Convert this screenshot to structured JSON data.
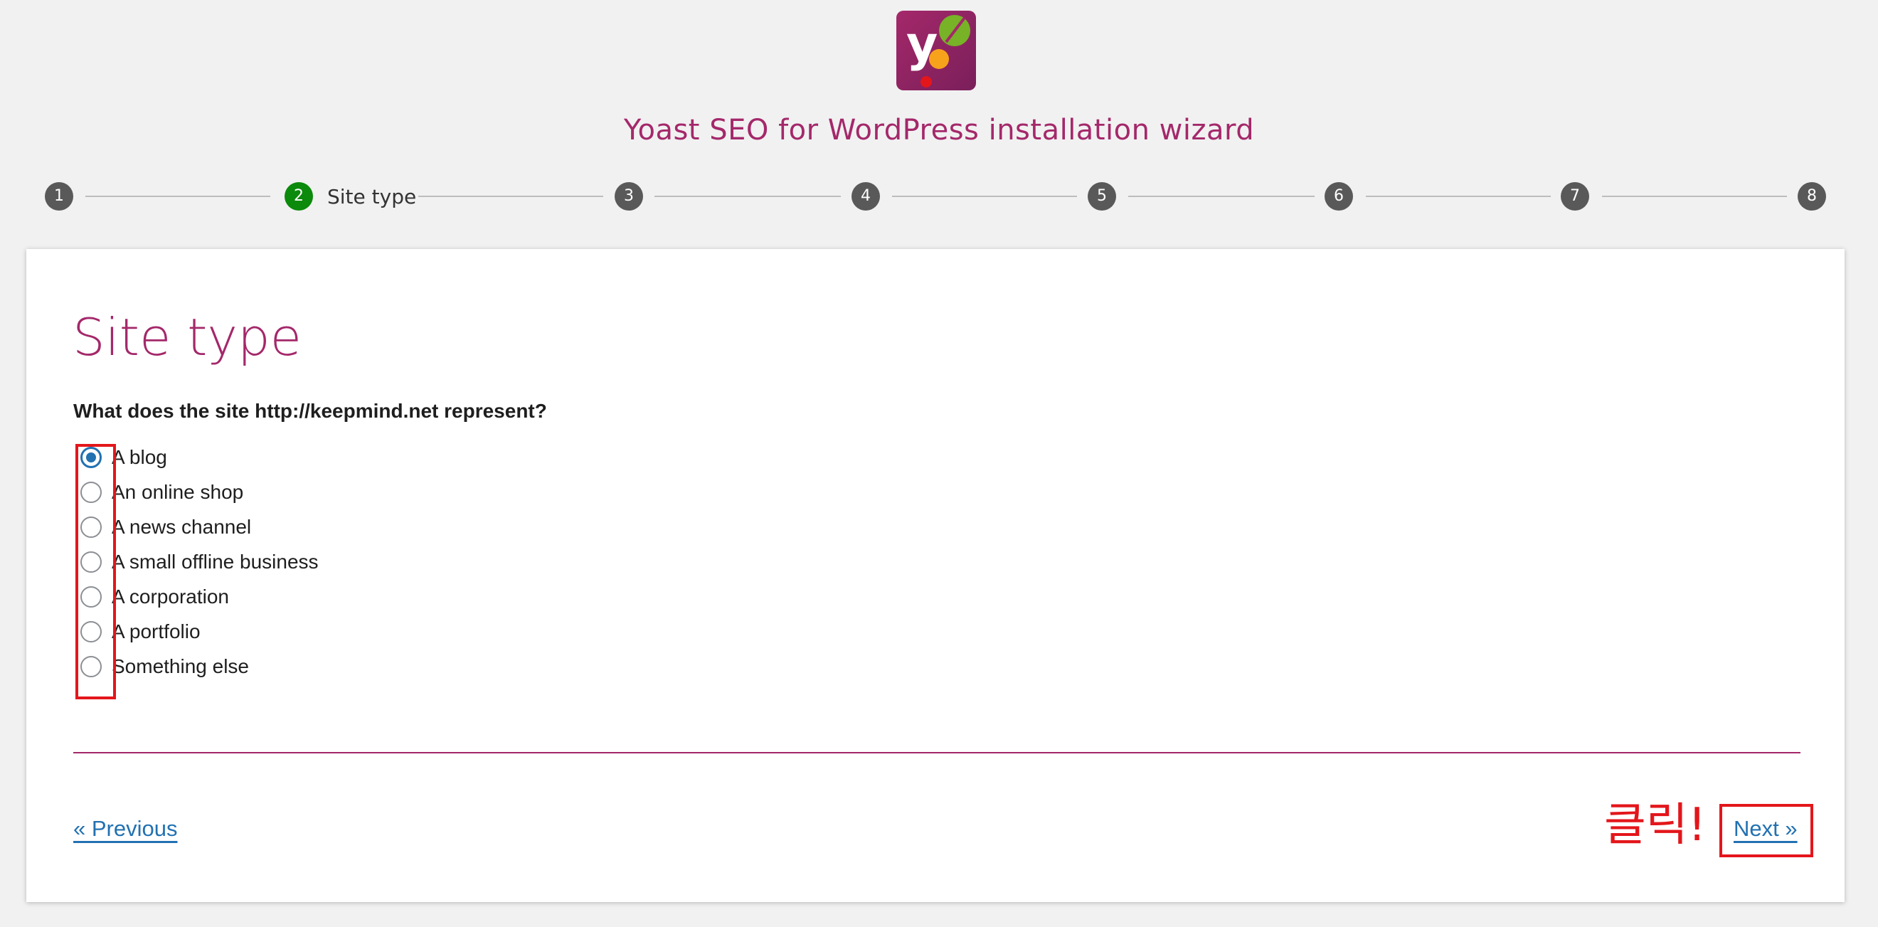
{
  "app": {
    "logo_icon": "yoast-logo-icon",
    "title": "Yoast SEO for WordPress installation wizard"
  },
  "stepper": {
    "steps": [
      {
        "number": "1",
        "label": "",
        "active": false
      },
      {
        "number": "2",
        "label": "Site type",
        "active": true
      },
      {
        "number": "3",
        "label": "",
        "active": false
      },
      {
        "number": "4",
        "label": "",
        "active": false
      },
      {
        "number": "5",
        "label": "",
        "active": false
      },
      {
        "number": "6",
        "label": "",
        "active": false
      },
      {
        "number": "7",
        "label": "",
        "active": false
      },
      {
        "number": "8",
        "label": "",
        "active": false
      }
    ],
    "active_color": "#0b8a0b",
    "inactive_color": "#595959"
  },
  "main": {
    "heading": "Site type",
    "question": "What does the site http://keepmind.net represent?",
    "options": [
      {
        "label": "A blog",
        "checked": true
      },
      {
        "label": "An online shop",
        "checked": false
      },
      {
        "label": "A news channel",
        "checked": false
      },
      {
        "label": "A small offline business",
        "checked": false
      },
      {
        "label": "A corporation",
        "checked": false
      },
      {
        "label": "A portfolio",
        "checked": false
      },
      {
        "label": "Something else",
        "checked": false
      }
    ]
  },
  "navigation": {
    "previous_label": "« Previous",
    "next_label": "Next »"
  },
  "annotation": {
    "click_text": "클릭!",
    "highlight_color": "#e3161b"
  },
  "colors": {
    "brand": "#a4286a",
    "link": "#2271b1"
  }
}
